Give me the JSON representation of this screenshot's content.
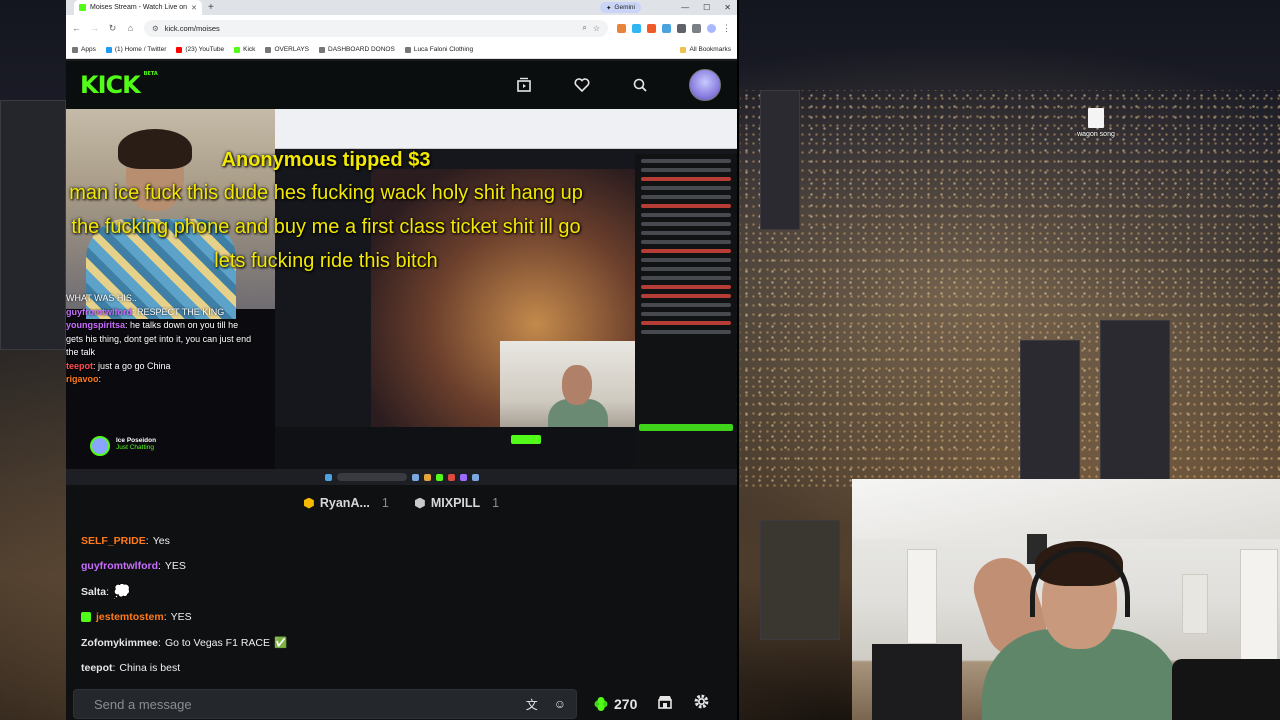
{
  "browser": {
    "tab_title": "Moises Stream - Watch Live on",
    "gemini_label": "Gemini",
    "url": "kick.com/moises",
    "bookmarks": [
      {
        "label": "Apps",
        "color": "#5f6368"
      },
      {
        "label": "(1) Home / Twitter",
        "color": "#1d9bf0"
      },
      {
        "label": "(23) YouTube",
        "color": "#ff0000"
      },
      {
        "label": "Kick",
        "color": "#53fc18"
      },
      {
        "label": "OVERLAYS",
        "color": "#888888"
      },
      {
        "label": "DASHBOARD DONOS",
        "color": "#888888"
      },
      {
        "label": "Luca Faloni Clothing",
        "color": "#888888"
      }
    ],
    "all_bookmarks": "All Bookmarks"
  },
  "kick": {
    "logo": "KICK",
    "beta": "BETA",
    "accent": "#53fc18"
  },
  "video": {
    "tip_title": "Anonymous tipped $3",
    "tip_message": "man ice fuck this dude hes fucking wack holy shit hang up the fucking phone and buy me a first class ticket shit ill go lets fucking ride this bitch",
    "overlay_chat": [
      {
        "user": "",
        "text": "WHAT WAS HIS..",
        "color": "plain"
      },
      {
        "user": "guyfromtwlford",
        "text": "RESPECT THE KING",
        "color": "purple"
      },
      {
        "user": "youngspiritsa",
        "text": "he talks down on you till he gets his thing, dont get into it, you can just end the talk",
        "color": "purple"
      },
      {
        "user": "teepot",
        "text": "just a go go China",
        "color": "red"
      },
      {
        "user": "rigavoo",
        "text": "",
        "color": "orange"
      }
    ],
    "inner_streamer": "Ice Poseidon",
    "inner_category": "Just Chatting"
  },
  "chat": {
    "pinned": [
      {
        "name": "RyanA...",
        "count": "1",
        "color": "#f5b800"
      },
      {
        "name": "MIXPILL",
        "count": "1",
        "color": "#c9c9c9"
      }
    ],
    "messages": [
      {
        "user": "SELF_PRIDE",
        "text": "Yes",
        "color": "#ff7a1a",
        "badge": false,
        "emote": ""
      },
      {
        "user": "guyfromtwlford",
        "text": "YES",
        "color": "#c96dff",
        "badge": false,
        "emote": ""
      },
      {
        "user": "Salta",
        "text": "",
        "color": "#e6e6e6",
        "badge": false,
        "emote": "💭"
      },
      {
        "user": "jestemtostem",
        "text": "YES",
        "color": "#ff7a1a",
        "badge": true,
        "emote": ""
      },
      {
        "user": "Zofomykimmee",
        "text": "Go to Vegas F1 RACE",
        "color": "#e6e6e6",
        "badge": false,
        "emote": "✅"
      },
      {
        "user": "teepot",
        "text": "China is best",
        "color": "#e6e6e6",
        "badge": false,
        "emote": ""
      }
    ],
    "input_placeholder": "Send a message",
    "points": "270"
  },
  "desktop": {
    "file_label": "wagon song"
  }
}
